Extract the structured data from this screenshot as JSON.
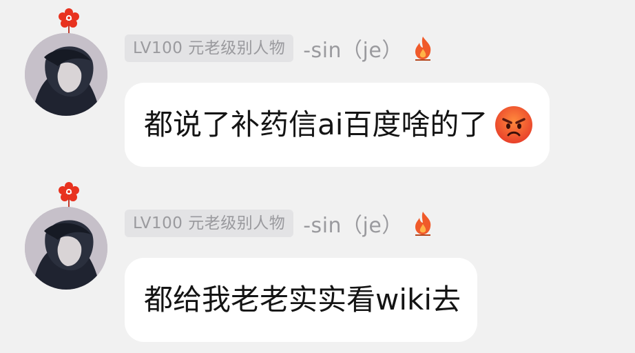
{
  "messages": [
    {
      "badge": "LV100 元老级别人物",
      "username": "-sin（je）",
      "text": "都说了补药信ai百度啥的了",
      "emoji": "angry-face-emoji"
    },
    {
      "badge": "LV100 元老级别人物",
      "username": "-sin（je）",
      "text": "都给我老老实实看wiki去",
      "emoji": ""
    }
  ],
  "colors": {
    "background": "#f1f1f1",
    "bubble": "#ffffff",
    "badge_bg": "#e3e3e5",
    "meta_text": "#9a9a9e",
    "fire": "#f05a2a",
    "flower": "#e8321f"
  },
  "icons": [
    "red-flower-icon",
    "fire-icon",
    "angry-face-emoji"
  ]
}
